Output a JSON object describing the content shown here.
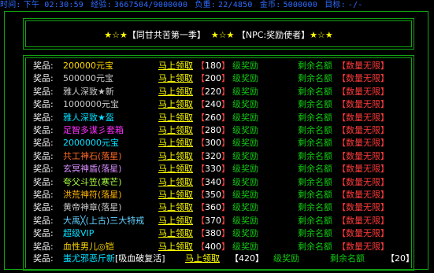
{
  "status_bar": {
    "time_label": "时间:",
    "time_value": "下午 02:30:59",
    "exp_label": "经验:",
    "exp_value": "3667504/9000000",
    "weight_label": "负重:",
    "weight_value": "22/4850",
    "gold_label": "金币:",
    "gold_value": "5000000",
    "target_label": "目标:",
    "target_value": "-/-"
  },
  "title": {
    "stars": "★☆★",
    "event": "【同甘共苦第一季】",
    "npc": "【NPC:奖励使者】"
  },
  "rewards": [
    {
      "label": "奖品:",
      "item": "200000元宝",
      "color": "#ffd800",
      "button": "马上领取",
      "level": "180",
      "award": "级奖励",
      "remain": "剩余名额",
      "qty": "【数量无限】"
    },
    {
      "label": "奖品:",
      "item": "500000元宝",
      "color": "#c8c8c8",
      "button": "马上领取",
      "level": "200",
      "award": "级奖励",
      "remain": "剩余名额",
      "qty": "【数量无限】"
    },
    {
      "label": "奖品:",
      "item": "雅人深致★新",
      "color": "#c8c8c8",
      "button": "马上领取",
      "level": "220",
      "award": "级奖励",
      "remain": "剩余名额",
      "qty": "【数量无限】"
    },
    {
      "label": "奖品:",
      "item": "1000000元宝",
      "color": "#c8c8c8",
      "button": "马上领取",
      "level": "240",
      "award": "级奖励",
      "remain": "剩余名额",
      "qty": "【数量无限】"
    },
    {
      "label": "奖品:",
      "item": "雅人深致★盔",
      "color": "#00e0ff",
      "button": "马上领取",
      "level": "260",
      "award": "级奖励",
      "remain": "剩余名额",
      "qty": "【数量无限】"
    },
    {
      "label": "奖品:",
      "item": "足智多谋彡套箱",
      "color": "#ff30ff",
      "button": "马上领取",
      "level": "280",
      "award": "级奖励",
      "remain": "剩余名额",
      "qty": "【数量无限】"
    },
    {
      "label": "奖品:",
      "item": "2000000元宝",
      "color": "#00e0ff",
      "button": "马上领取",
      "level": "300",
      "award": "级奖励",
      "remain": "剩余名额",
      "qty": "【数量无限】"
    },
    {
      "label": "奖品:",
      "item": "共工神石(落星)",
      "color": "#ff6a28",
      "button": "马上领取",
      "level": "320",
      "award": "级奖励",
      "remain": "剩余名额",
      "qty": "【数量无限】"
    },
    {
      "label": "奖品:",
      "item": "玄冥神盾(落星)",
      "color": "#d88cff",
      "button": "马上领取",
      "level": "330",
      "award": "级奖励",
      "remain": "剩余名额",
      "qty": "【数量无限】"
    },
    {
      "label": "奖品:",
      "item": "夸父斗笠(寒芒)",
      "color": "#a8ff40",
      "button": "马上领取",
      "level": "340",
      "award": "级奖励",
      "remain": "剩余名额",
      "qty": "【数量无限】"
    },
    {
      "label": "奖品:",
      "item": "洪荒神符(落星)",
      "color": "#ffb400",
      "button": "马上领取",
      "level": "350",
      "award": "级奖励",
      "remain": "剩余名额",
      "qty": "【数量无限】"
    },
    {
      "label": "奖品:",
      "item": "黄帝神章(落星)",
      "color": "#c8c8c8",
      "button": "马上领取",
      "level": "360",
      "award": "级奖励",
      "remain": "剩余名额",
      "qty": "【数量无限】"
    },
    {
      "label": "奖品:",
      "item": "大禹╳(上古)三大特戒",
      "color": "#60d0ff",
      "button": "马上领取",
      "level": "370",
      "award": "级奖励",
      "remain": "剩余名额",
      "qty": "【数量无限】"
    },
    {
      "label": "奖品:",
      "item": "超级VIP",
      "color": "#00e0ff",
      "button": "马上领取",
      "level": "380",
      "award": "级奖励",
      "remain": "剩余名额",
      "qty": "【数量无限】"
    },
    {
      "label": "奖品:",
      "item": "血性男儿◎铠",
      "color": "#ffd800",
      "button": "马上领取",
      "level": "400",
      "award": "级奖励",
      "remain": "剩余名额",
      "qty": "【数量无限】"
    }
  ],
  "last_row": {
    "label": "奖品:",
    "item": "蚩尤邪恶斤新",
    "note": "[吸血破复活]",
    "button": "马上领取",
    "level": "【420】",
    "award": "级奖励",
    "remain": "剩余名额",
    "count": "【20】"
  }
}
